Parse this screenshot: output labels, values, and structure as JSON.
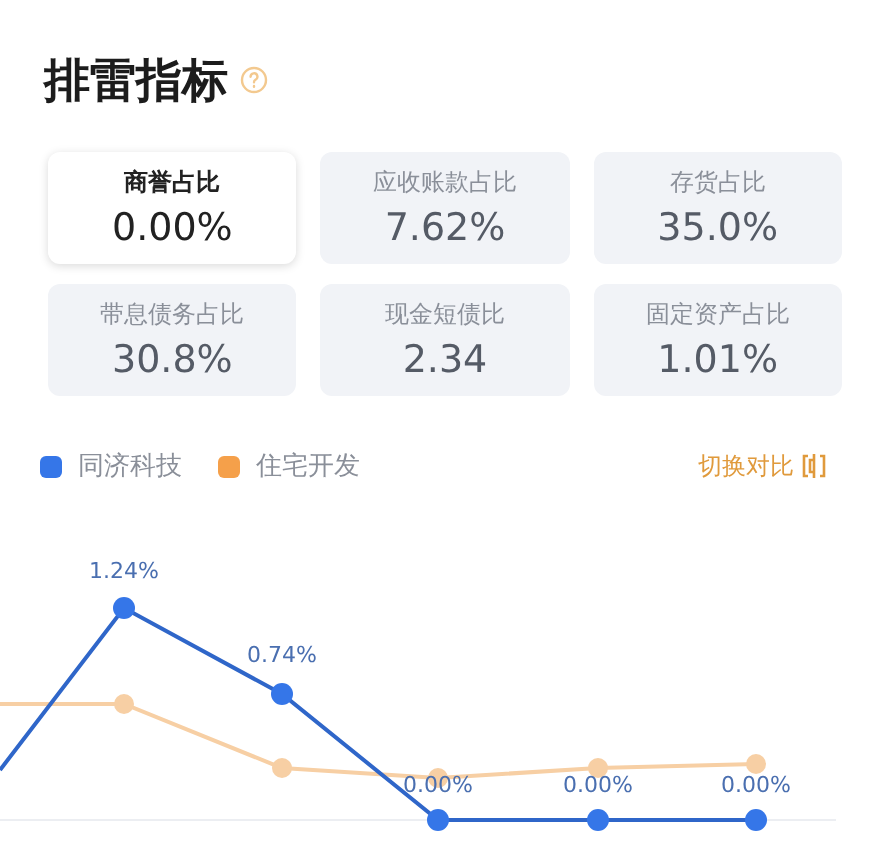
{
  "title": "排雷指标",
  "metrics": [
    {
      "label": "商誉占比",
      "value": "0.00%",
      "selected": true
    },
    {
      "label": "应收账款占比",
      "value": "7.62%",
      "selected": false
    },
    {
      "label": "存货占比",
      "value": "35.0%",
      "selected": false
    },
    {
      "label": "带息债务占比",
      "value": "30.8%",
      "selected": false
    },
    {
      "label": "现金短债比",
      "value": "2.34",
      "selected": false
    },
    {
      "label": "固定资产占比",
      "value": "1.01%",
      "selected": false
    }
  ],
  "legend": [
    {
      "name": "同济科技",
      "color": "#3576e8"
    },
    {
      "name": "住宅开发",
      "color": "#f5a04a"
    }
  ],
  "toggle": "切换对比",
  "point_labels": [
    "1.24%",
    "0.74%",
    "0.00%",
    "0.00%",
    "0.00%"
  ]
}
